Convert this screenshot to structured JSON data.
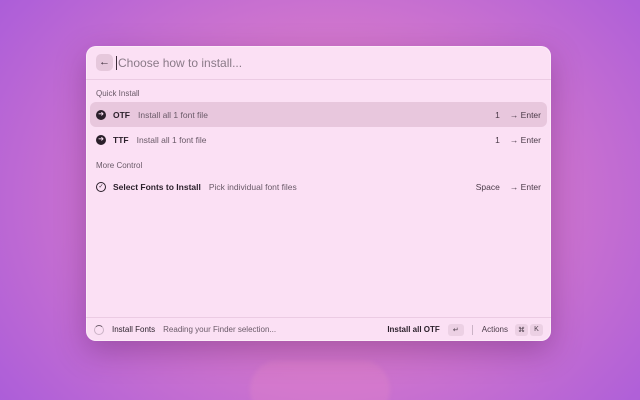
{
  "search": {
    "placeholder": "Choose how to install..."
  },
  "icons": {
    "back": "arrow-left-icon",
    "install": "arrow-circle-right-icon",
    "select": "check-circle-icon"
  },
  "sections": {
    "quick": "Quick Install",
    "more": "More Control"
  },
  "rows": [
    {
      "title": "OTF",
      "subtitle": "Install all 1 font file",
      "count": "1",
      "action": "→ Enter"
    },
    {
      "title": "TTF",
      "subtitle": "Install all 1 font file",
      "count": "1",
      "action": "→ Enter"
    },
    {
      "title": "Select Fonts to Install",
      "subtitle": "Pick individual font files",
      "count": "Space",
      "action": "→ Enter"
    }
  ],
  "footer": {
    "title": "Install Fonts",
    "status": "Reading your Finder selection...",
    "primary_action": "Install all OTF",
    "primary_key": "↵",
    "actions_label": "Actions",
    "key_cmd": "⌘",
    "key_k": "K"
  },
  "colors": {
    "panel": "#fbe0f4",
    "selected_row": "#e8c7dd",
    "background_accent": "#d478cc"
  }
}
